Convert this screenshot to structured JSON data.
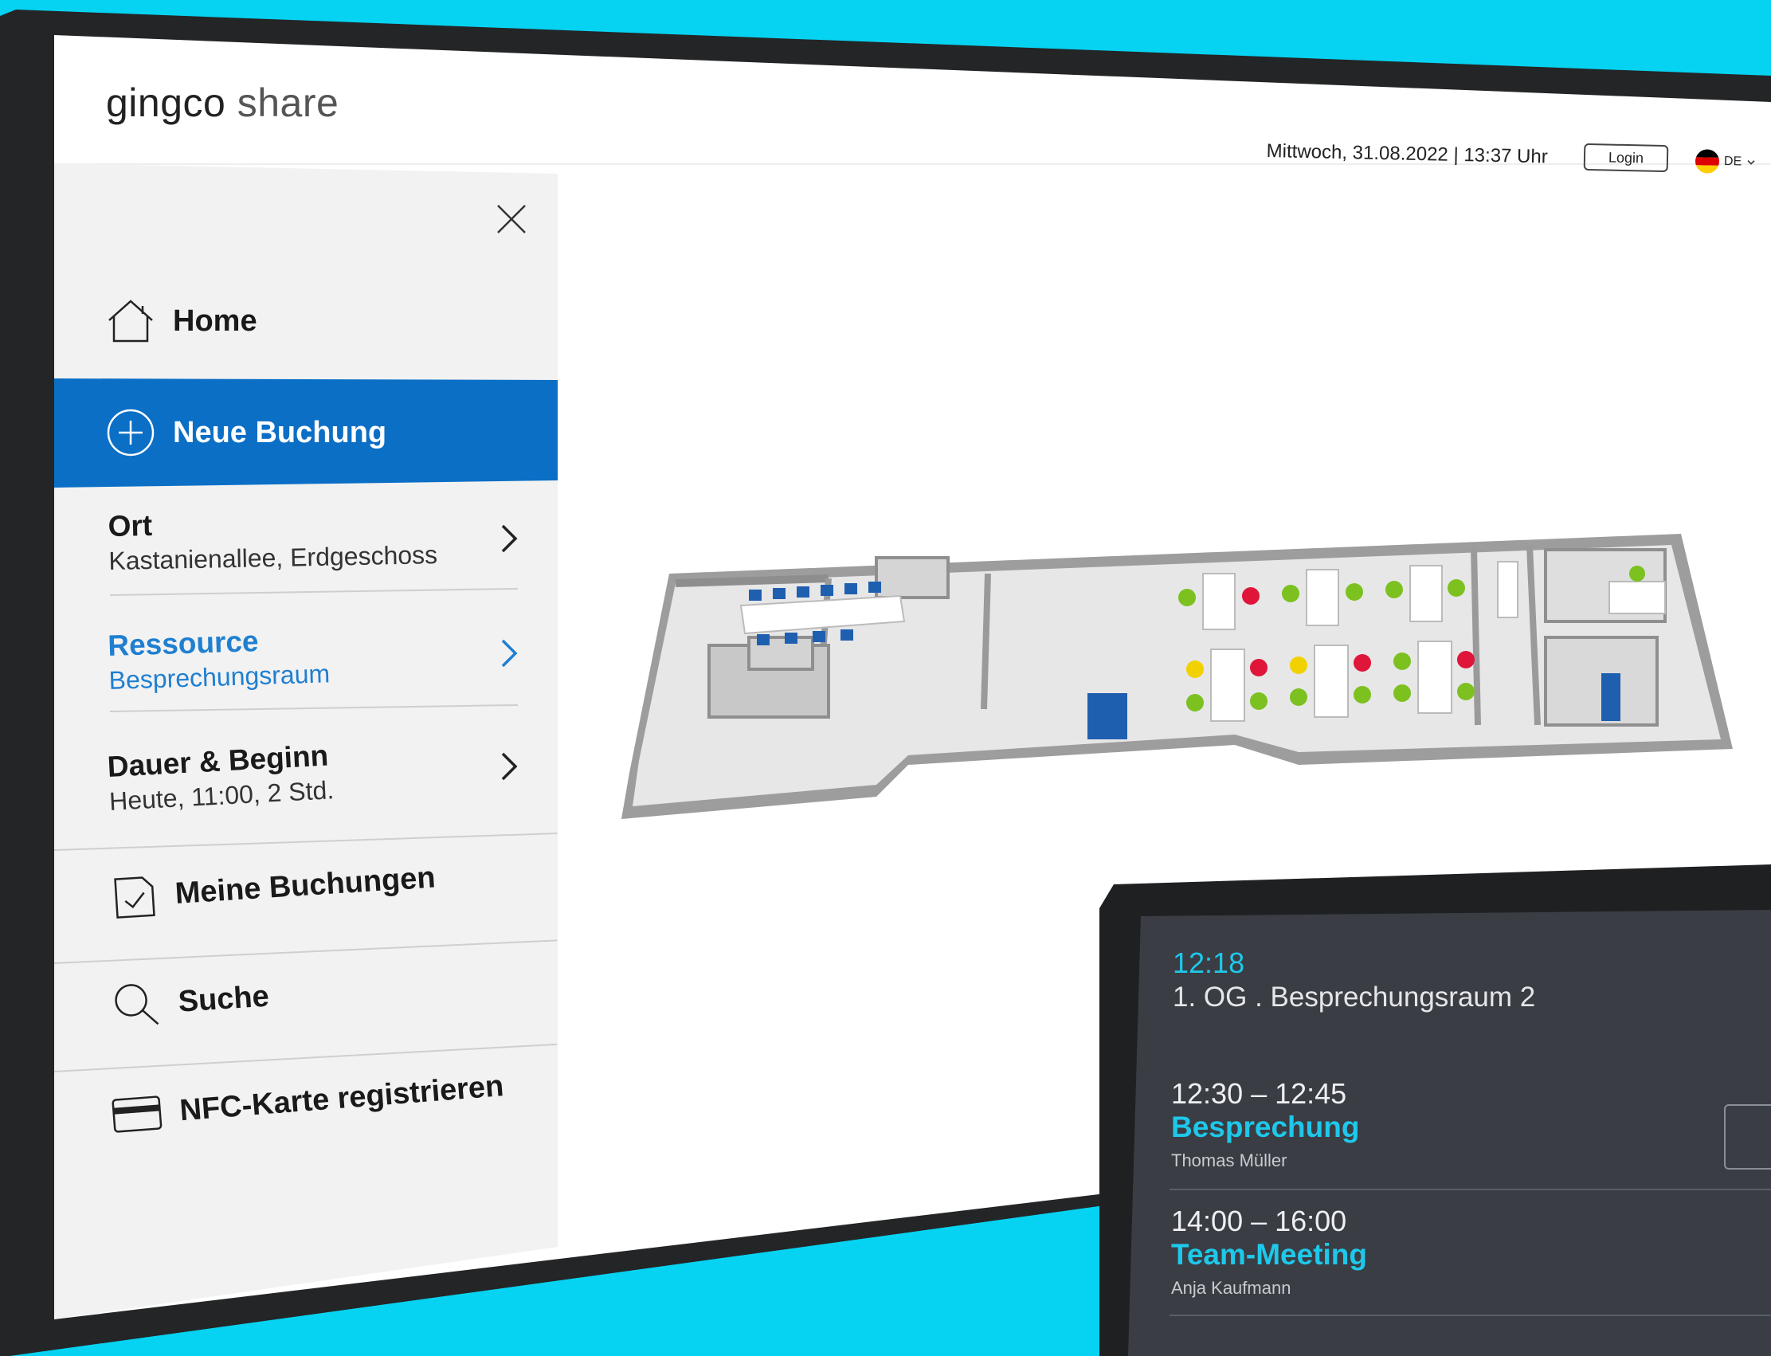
{
  "app": {
    "brand": "gingco",
    "brand_suffix": "share"
  },
  "header": {
    "datetime": "Mittwoch, 31.08.2022 | 13:37 Uhr",
    "login_label": "Login",
    "language": "DE"
  },
  "sidebar": {
    "home_label": "Home",
    "new_booking_label": "Neue Buchung",
    "location": {
      "title": "Ort",
      "value": "Kastanienallee, Erdgeschoss"
    },
    "resource": {
      "title": "Ressource",
      "value": "Besprechungsraum"
    },
    "duration": {
      "title": "Dauer & Beginn",
      "value": "Heute, 11:00, 2 Std."
    },
    "my_bookings_label": "Meine Buchungen",
    "search_label": "Suche",
    "nfc_label": "NFC-Karte registrieren"
  },
  "tablet": {
    "time": "12:18",
    "room": "1. OG . Besprechungsraum 2",
    "bookings": [
      {
        "time": "12:30 – 12:45",
        "title": "Besprechung",
        "person": "Thomas Müller"
      },
      {
        "time": "14:00 – 16:00",
        "title": "Team-Meeting",
        "person": "Anja Kaufmann"
      }
    ]
  },
  "colors": {
    "background": "#06d3f2",
    "accent": "#0b6fc6",
    "tablet_accent": "#1ec8ea",
    "seat_free": "#7cc11f",
    "seat_busy": "#e0153a",
    "seat_pending": "#f2d100"
  }
}
